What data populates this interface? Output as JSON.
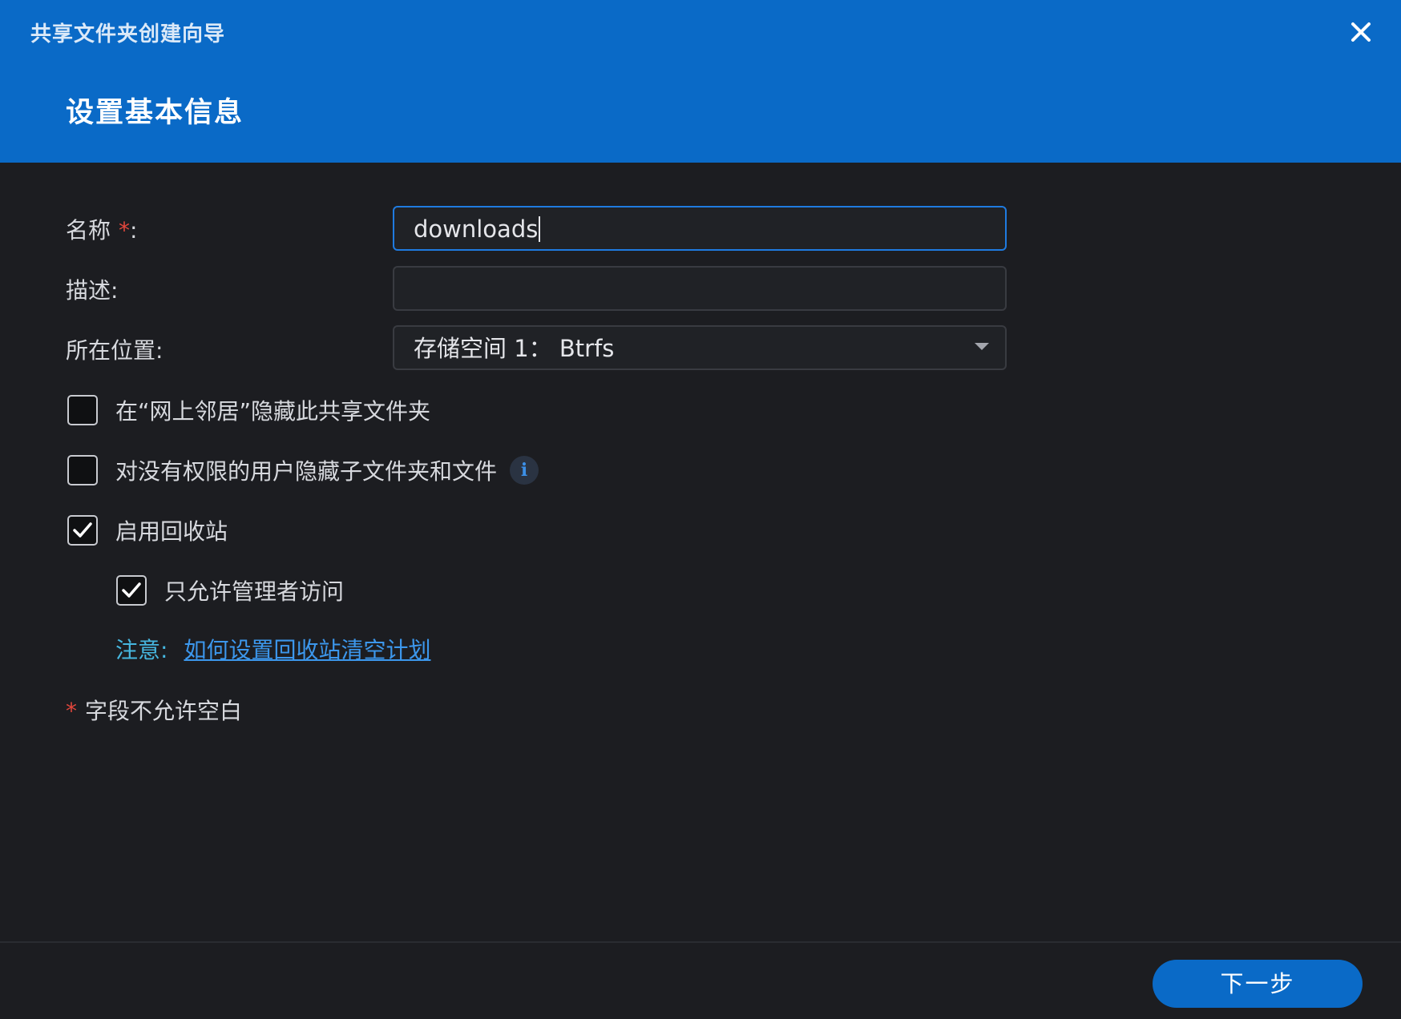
{
  "window": {
    "wizard_title": "共享文件夹创建向导",
    "step_title": "设置基本信息"
  },
  "form": {
    "name": {
      "label": "名称",
      "required_mark": "*",
      "colon": ":",
      "value": "downloads"
    },
    "description": {
      "label": "描述:",
      "value": ""
    },
    "location": {
      "label": "所在位置:",
      "selected": "存储空间 1： Btrfs"
    }
  },
  "options": [
    {
      "label": "在“网上邻居”隐藏此共享文件夹",
      "checked": false
    },
    {
      "label": "对没有权限的用户隐藏子文件夹和文件",
      "checked": false,
      "info_icon": "i"
    },
    {
      "label": "启用回收站",
      "checked": true
    },
    {
      "label": "只允许管理者访问",
      "checked": true
    }
  ],
  "note": {
    "label": "注意:",
    "link_text": "如何设置回收站清空计划"
  },
  "required_note": {
    "star": "*",
    "text": "字段不允许空白"
  },
  "footer": {
    "next_label": "下一步"
  },
  "colors": {
    "header": "#0a6ac7",
    "background": "#1c1d21",
    "focus_border": "#1f7be0",
    "required": "#e2463c",
    "link": "#3c97ec"
  }
}
